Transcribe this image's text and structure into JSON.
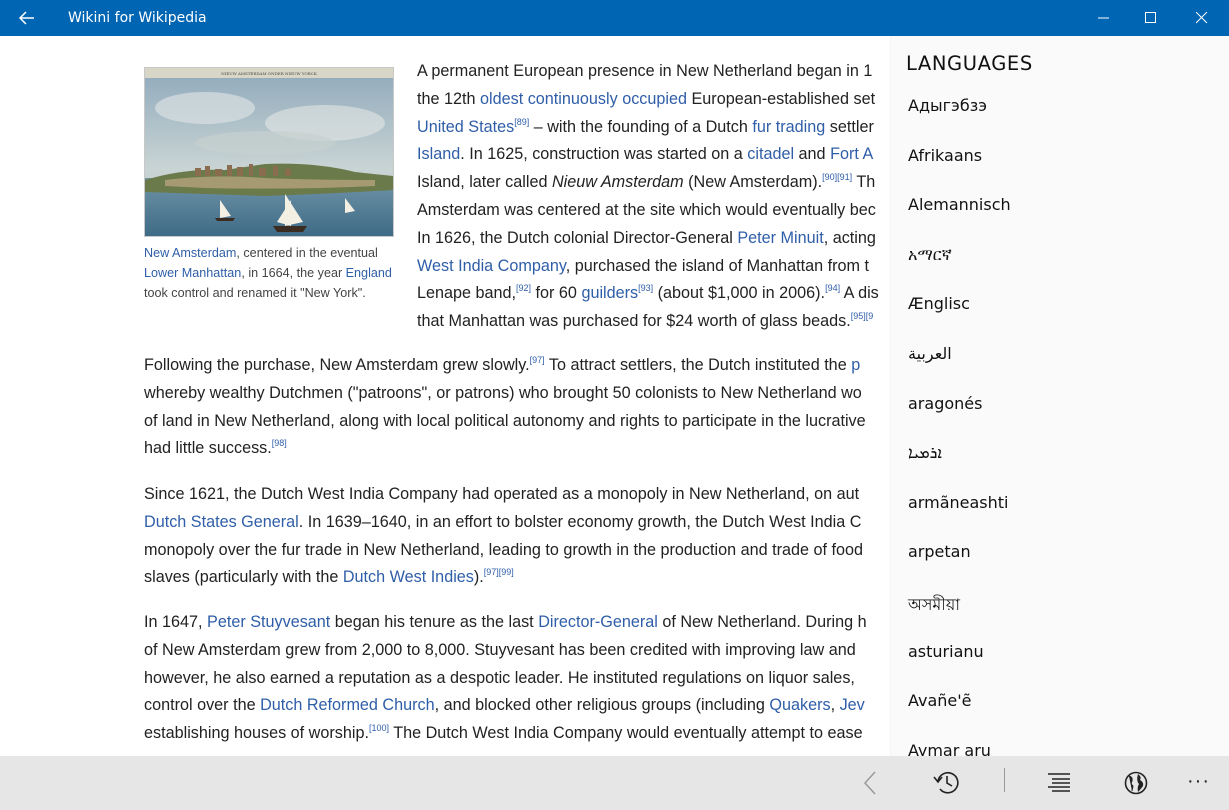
{
  "window": {
    "title": "Wikini for Wikipedia"
  },
  "figure": {
    "caption_parts": {
      "link1": "New Amsterdam",
      "t1": ", centered in the eventual ",
      "link2": "Lower Manhattan",
      "t2": ", in 1664, the year ",
      "link3": "England",
      "t3": " took control and renamed it \"New York\"."
    }
  },
  "para1": {
    "l1": "A permanent European presence in New Netherland began in 1",
    "l2a": "the 12th ",
    "l2link": "oldest continuously occupied",
    "l2b": " European-established set",
    "l3link": "United States",
    "l3sup": "[89]",
    "l3b": " – with the founding of a Dutch ",
    "l3link2": "fur trading",
    "l3c": " settler",
    "l4link": "Island",
    "l4a": ". In 1625, construction was started on a ",
    "l4link2": "citadel",
    "l4b": " and ",
    "l4link3": "Fort A",
    "l5a": "Island, later called ",
    "l5i": "Nieuw Amsterdam",
    "l5b": " (New Amsterdam).",
    "l5sup": "[90][91]",
    "l5c": " Th",
    "l6": "Amsterdam was centered at the site which would eventually bec",
    "l7a": "In 1626, the Dutch colonial Director-General ",
    "l7link": "Peter Minuit",
    "l7b": ", acting",
    "l8link": "West India Company",
    "l8a": ", purchased the island of Manhattan from t",
    "l9a": "Lenape band,",
    "l9sup1": "[92]",
    "l9b": " for 60 ",
    "l9link": "guilders",
    "l9sup2": "[93]",
    "l9c": " (about $1,000 in 2006).",
    "l9sup3": "[94]",
    "l9d": " A dis",
    "l10a": "that Manhattan was purchased for $24 worth of glass beads.",
    "l10sup": "[95][9"
  },
  "para2": {
    "l1a": "Following the purchase, New Amsterdam grew slowly.",
    "l1sup": "[97]",
    "l1b": " To attract settlers, the Dutch instituted the ",
    "l1link": "p",
    "l2": "whereby wealthy Dutchmen (\"patroons\", or patrons) who brought 50 colonists to New Netherland wo",
    "l3": "of land in New Netherland, along with local political autonomy and rights to participate in the lucrative",
    "l4a": "had little success.",
    "l4sup": "[98]"
  },
  "para3": {
    "l1": "Since 1621, the Dutch West India Company had operated as a monopoly in New Netherland, on aut",
    "l2link": "Dutch States General",
    "l2a": ". In 1639–1640, in an effort to bolster economy growth, the Dutch West India C",
    "l3": "monopoly over the fur trade in New Netherland, leading to growth in the production and trade of food",
    "l4a": "slaves (particularly with the ",
    "l4link": "Dutch West Indies",
    "l4b": ").",
    "l4sup": "[97][99]"
  },
  "para4": {
    "l1a": "In 1647, ",
    "l1link": "Peter Stuyvesant",
    "l1b": " began his tenure as the last ",
    "l1link2": "Director-General",
    "l1c": " of New Netherland. During h",
    "l2": "of New Amsterdam grew from 2,000 to 8,000. Stuyvesant has been credited with improving law and",
    "l3": "however, he also earned a reputation as a despotic leader. He instituted regulations on liquor sales,",
    "l4a": "control over the ",
    "l4link": "Dutch Reformed Church",
    "l4b": ", and blocked other religious groups (including ",
    "l4link2": "Quakers",
    "l4c": ", ",
    "l4link3": "Jev",
    "l5a": "establishing houses of worship.",
    "l5sup": "[100]",
    "l5b": " The Dutch West India Company would eventually attempt to ease"
  },
  "languages": {
    "heading": "LANGUAGES",
    "items": [
      "Адыгэбзэ",
      "Afrikaans",
      "Alemannisch",
      "አማርኛ",
      "Ænglisc",
      "العربية",
      "aragonés",
      "ܐܪܡܝܐ",
      "armãneashti",
      "arpetan",
      "অসমীয়া",
      "asturianu",
      "Avañe'ẽ",
      "Aymar aru"
    ]
  },
  "commandbar": {
    "back_icon": "chevron-left-icon",
    "history_icon": "history-icon",
    "toc_icon": "table-of-contents-icon",
    "language_icon": "globe-icon",
    "more_label": "···"
  },
  "colors": {
    "titlebar": "#0065b3",
    "link": "#2f5ea8",
    "commandbar": "#e6e6e6"
  }
}
